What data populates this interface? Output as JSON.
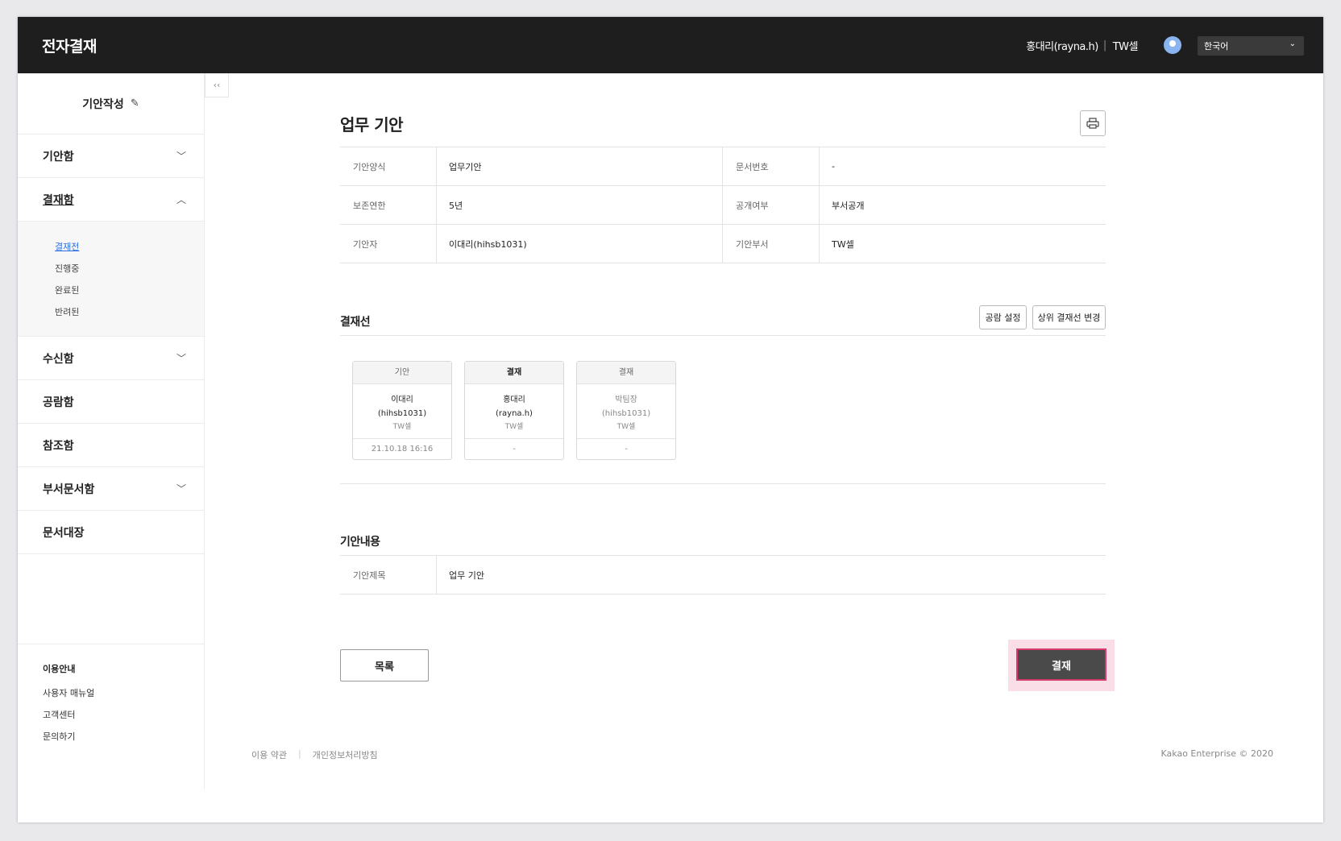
{
  "header": {
    "app_title": "전자결재",
    "user_name": "홍대리(rayna.h)",
    "user_team": "TW셀",
    "language": "한국어",
    "avatar_icon": "user-avatar-icon"
  },
  "sidebar": {
    "compose_label": "기안작성",
    "compose_icon": "pencil-icon",
    "items": [
      {
        "label": "기안함",
        "expanded": false
      },
      {
        "label": "결재함",
        "expanded": true
      },
      {
        "label": "수신함",
        "expanded": false
      },
      {
        "label": "공람함"
      },
      {
        "label": "참조함"
      },
      {
        "label": "부서문서함",
        "expanded": false
      },
      {
        "label": "문서대장"
      }
    ],
    "sub_items": [
      "결재전",
      "진행중",
      "완료된",
      "반려된"
    ],
    "selected_sub": "결재전",
    "guide_title": "이용안내",
    "guide_links": [
      "사용자 매뉴얼",
      "고객센터",
      "문의하기"
    ]
  },
  "main": {
    "title": "업무 기안",
    "info": [
      {
        "label1": "기안양식",
        "value1": "업무기안",
        "label2": "문서번호",
        "value2": "-"
      },
      {
        "label1": "보존연한",
        "value1": "5년",
        "label2": "공개여부",
        "value2": "부서공개"
      },
      {
        "label1": "기안자",
        "value1": "이대리(hihsb1031)",
        "label2": "기안부서",
        "value2": "TW셀"
      }
    ],
    "approval_line_title": "결재선",
    "btn_share_setting": "공람 설정",
    "btn_change_line": "상위 결재선 변경",
    "approvers": [
      {
        "role": "기안",
        "name": "이대리",
        "id": "(hihsb1031)",
        "dept": "TW셀",
        "date": "21.10.18 16:16"
      },
      {
        "role": "결재",
        "name": "홍대리",
        "id": "(rayna.h)",
        "dept": "TW셀",
        "date": "-"
      },
      {
        "role": "결재",
        "name": "박팀장",
        "id": "(hihsb1031)",
        "dept": "TW셀",
        "date": "-"
      }
    ],
    "content_title": "기안내용",
    "content_label": "기안제목",
    "content_value": "업무 기안",
    "btn_list": "목록",
    "btn_approve": "결재"
  },
  "footer": {
    "terms": "이용 약관",
    "privacy": "개인정보처리방침",
    "copyright": "Kakao Enterprise © 2020"
  },
  "colors": {
    "header_bg": "#1e1e1e",
    "link_blue": "#2f6fe0",
    "approve_bg": "#4a4a4a",
    "approve_highlight": "#d43a6a"
  }
}
